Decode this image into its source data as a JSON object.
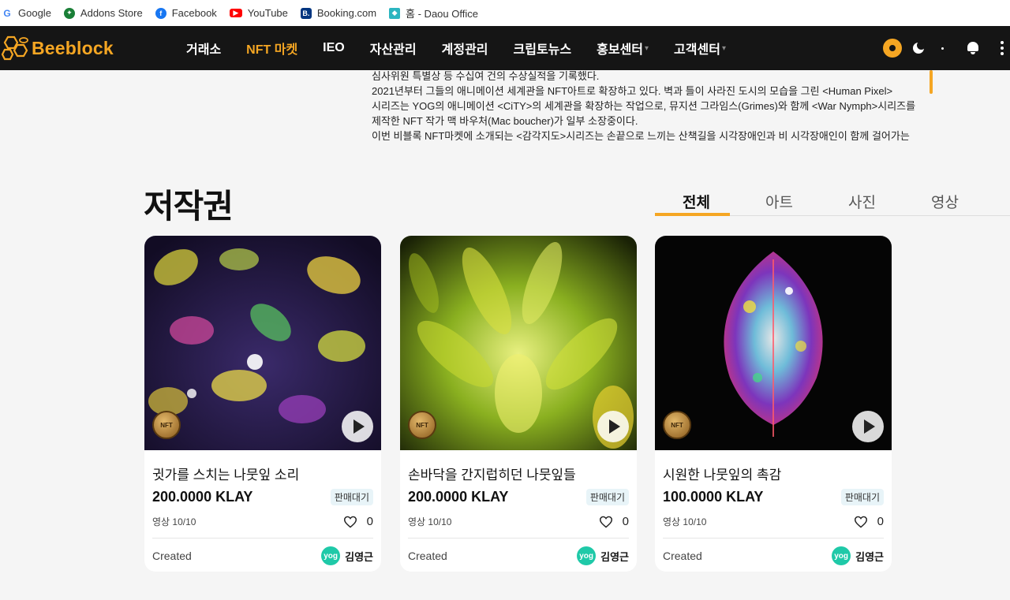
{
  "bookmarks": [
    {
      "label": "Google",
      "icon": "google-icon"
    },
    {
      "label": "Addons Store",
      "icon": "addons-store-icon"
    },
    {
      "label": "Facebook",
      "icon": "facebook-icon"
    },
    {
      "label": "YouTube",
      "icon": "youtube-icon"
    },
    {
      "label": "Booking.com",
      "icon": "booking-icon"
    },
    {
      "label": "홈 - Daou Office",
      "icon": "daou-office-icon"
    }
  ],
  "nav": {
    "logo_text": "Beeblock",
    "items": [
      {
        "label": "거래소"
      },
      {
        "label": "NFT 마켓",
        "active": true
      },
      {
        "label": "IEO"
      },
      {
        "label": "자산관리"
      },
      {
        "label": "계정관리"
      },
      {
        "label": "크립토뉴스"
      },
      {
        "label": "홍보센터",
        "caret": "▾"
      },
      {
        "label": "고객센터",
        "caret": "▾"
      }
    ],
    "accent_color": "#f5a623"
  },
  "description": {
    "lines": [
      "심사위원 특별상 등 수십여 건의 수상실적을 기록했다.",
      "2021년부터 그들의 애니메이션 세계관을 NFT아트로 확장하고 있다. 벽과 틀이 사라진 도시의 모습을 그린 <Human Pixel>",
      "시리즈는 YOG의 애니메이션 <CiTY>의 세계관을 확장하는 작업으로, 뮤지션 그라임스(Grimes)와 함께 <War Nymph>시리즈를",
      "제작한 NFT 작가 맥 바우처(Mac boucher)가 일부 소장중이다.",
      "이번 비블록 NFT마켓에 소개되는 <감각지도>시리즈는 손끝으로 느끼는 산책길을 시각장애인과 비 시각장애인이 함께 걸어가는"
    ]
  },
  "section": {
    "title": "저작권",
    "tabs": [
      {
        "label": "전체",
        "active": true
      },
      {
        "label": "아트"
      },
      {
        "label": "사진"
      },
      {
        "label": "영상"
      }
    ]
  },
  "cards": [
    {
      "title": "귓가를 스치는 나뭇잎 소리",
      "price": "200.0000 KLAY",
      "status": "판매대기",
      "category": "영상 10/10",
      "likes": "0",
      "created_label": "Created",
      "creator_avatar": "yog",
      "creator_name": "김영근",
      "nft_badge": "NFT"
    },
    {
      "title": "손바닥을 간지럽히던 나뭇잎들",
      "price": "200.0000 KLAY",
      "status": "판매대기",
      "category": "영상 10/10",
      "likes": "0",
      "created_label": "Created",
      "creator_avatar": "yog",
      "creator_name": "김영근",
      "nft_badge": "NFT"
    },
    {
      "title": "시원한 나뭇잎의 촉감",
      "price": "100.0000 KLAY",
      "status": "판매대기",
      "category": "영상 10/10",
      "likes": "0",
      "created_label": "Created",
      "creator_avatar": "yog",
      "creator_name": "김영근",
      "nft_badge": "NFT"
    }
  ]
}
